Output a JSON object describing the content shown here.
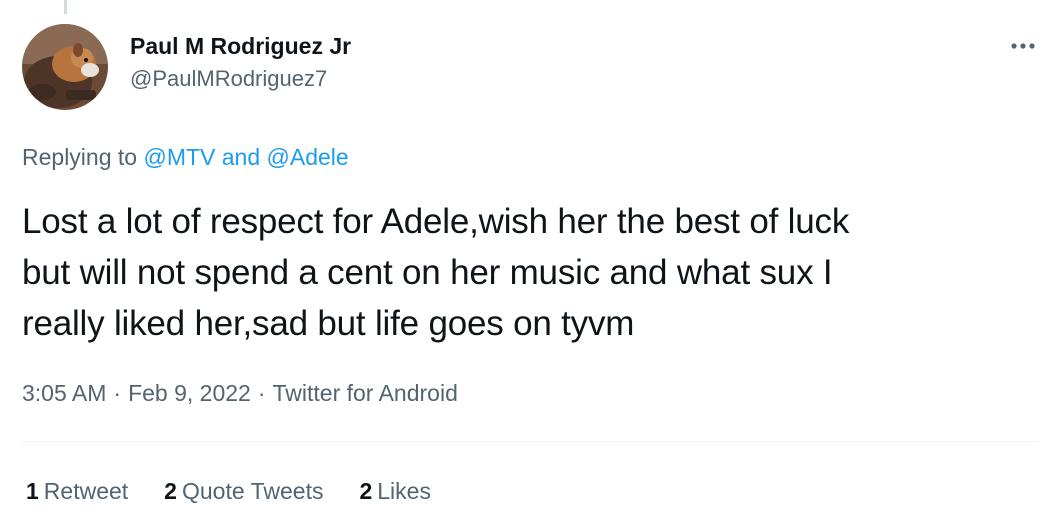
{
  "author": {
    "display_name": "Paul M Rodriguez Jr",
    "handle": "@PaulMRodriguez7",
    "avatar": "dog-photo-avatar"
  },
  "menu": {
    "icon": "more-horizontal-icon"
  },
  "reply_context": {
    "prefix": "Replying to",
    "mention_1": "@MTV",
    "conjunction": "and",
    "mention_2": "@Adele"
  },
  "tweet": {
    "text_line_1": "Lost a lot of respect for Adele,wish her the best of luck",
    "text_line_2": "but will not spend a cent on her music and what sux I",
    "text_line_3": "really liked her,sad but life goes on tyvm"
  },
  "meta": {
    "time": "3:05 AM",
    "separator": "·",
    "date": "Feb 9, 2022",
    "source": "Twitter for Android"
  },
  "stats": {
    "retweets_count": "1",
    "retweets_label": "Retweet",
    "quotes_count": "2",
    "quotes_label": "Quote Tweets",
    "likes_count": "2",
    "likes_label": "Likes"
  },
  "colors": {
    "primary_text": "#0f1419",
    "secondary_text": "#536471",
    "link": "#1d9bf0",
    "divider": "#eff3f4",
    "thread_line": "#cfd9de"
  }
}
